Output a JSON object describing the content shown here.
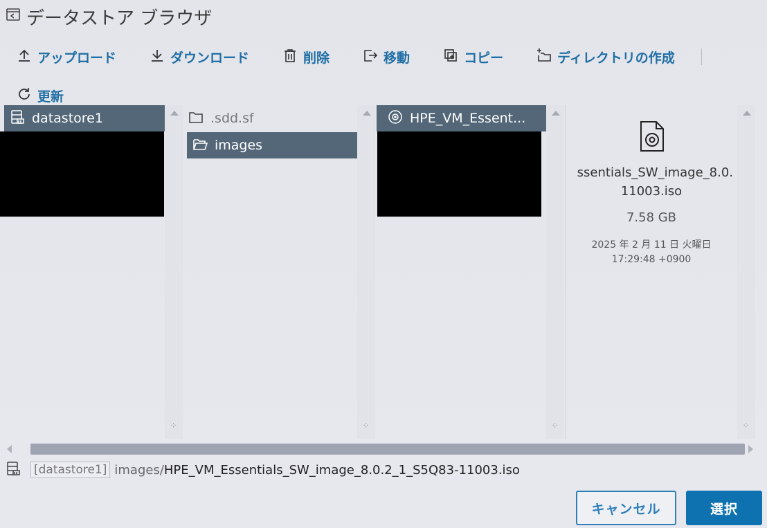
{
  "window": {
    "title": "データストア ブラウザ"
  },
  "toolbar": {
    "upload": "アップロード",
    "download": "ダウンロード",
    "delete": "削除",
    "move": "移動",
    "copy": "コピー",
    "mkdir": "ディレクトリの作成",
    "refresh": "更新"
  },
  "columns": {
    "datastores": {
      "items": [
        {
          "label": "datastore1",
          "selected": true
        }
      ]
    },
    "folders": {
      "items": [
        {
          "label": ".sdd.sf",
          "selected": false
        },
        {
          "label": "images",
          "selected": true
        }
      ]
    },
    "files": {
      "items": [
        {
          "label": "HPE_VM_Essent...",
          "selected": true
        }
      ]
    }
  },
  "preview": {
    "name_line1": "ssentials_SW_image_8.0.",
    "name_line2": "11003.iso",
    "size": "7.58 GB",
    "date_line1": "2025 年 2 月 11 日 火曜日",
    "date_line2": "17:29:48 +0900"
  },
  "path": {
    "datastore": "[datastore1]",
    "dir": "images/",
    "file": "HPE_VM_Essentials_SW_image_8.0.2_1_S5Q83-11003.iso"
  },
  "buttons": {
    "cancel": "キャンセル",
    "select": "選択"
  },
  "colors": {
    "accent": "#1f6ea5",
    "selected_row": "#546778",
    "primary_button": "#0f72b0"
  }
}
